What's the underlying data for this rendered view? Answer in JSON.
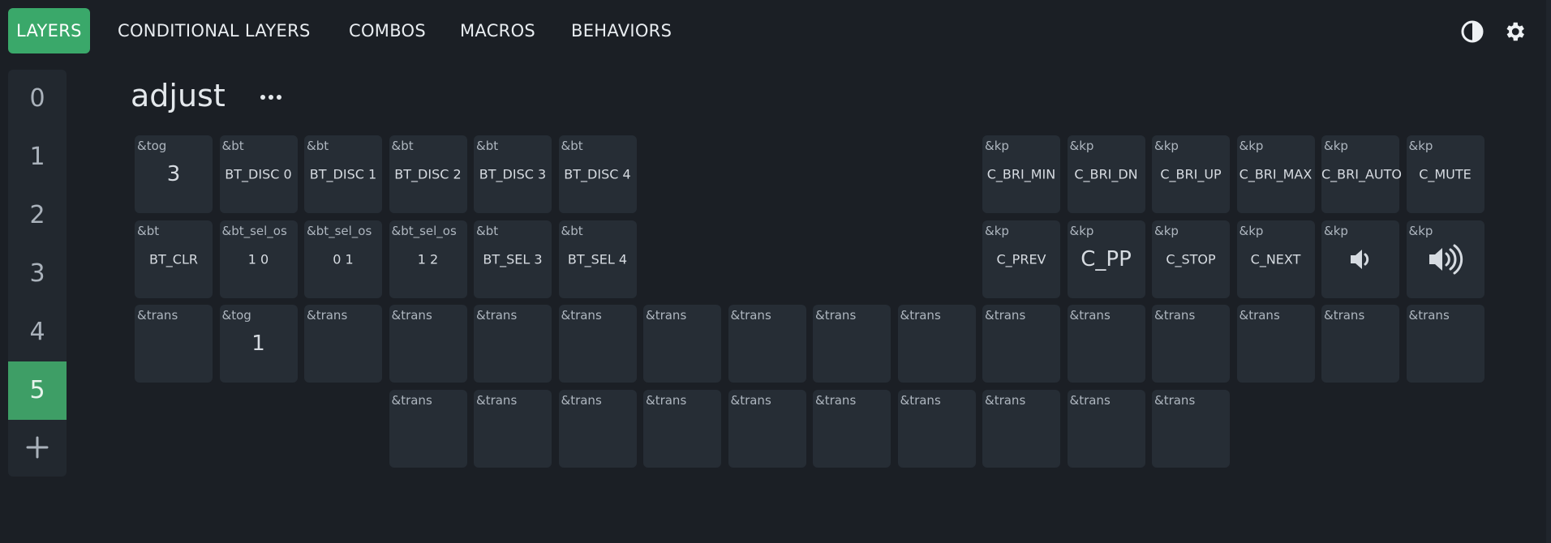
{
  "nav": {
    "tabs": [
      {
        "label": "LAYERS",
        "active": true
      },
      {
        "label": "CONDITIONAL LAYERS",
        "active": false
      },
      {
        "label": "COMBOS",
        "active": false
      },
      {
        "label": "MACROS",
        "active": false
      },
      {
        "label": "BEHAVIORS",
        "active": false
      }
    ],
    "icons": [
      "contrast-icon",
      "gear-icon"
    ]
  },
  "sidebar": {
    "layers": [
      "0",
      "1",
      "2",
      "3",
      "4",
      "5"
    ],
    "active_layer": "5",
    "add_icon": "plus-icon"
  },
  "layer": {
    "title": "adjust",
    "menu_icon": "more-horizontal-icon"
  },
  "keys": {
    "r0": [
      {
        "beh": "&tog",
        "param": "3",
        "size": "big"
      },
      {
        "beh": "&bt",
        "param": "BT_DISC 0"
      },
      {
        "beh": "&bt",
        "param": "BT_DISC 1"
      },
      {
        "beh": "&bt",
        "param": "BT_DISC 2"
      },
      {
        "beh": "&bt",
        "param": "BT_DISC 3"
      },
      {
        "beh": "&bt",
        "param": "BT_DISC 4"
      },
      {
        "beh": "&kp",
        "param": "C_BRI_MIN"
      },
      {
        "beh": "&kp",
        "param": "C_BRI_DN"
      },
      {
        "beh": "&kp",
        "param": "C_BRI_UP"
      },
      {
        "beh": "&kp",
        "param": "C_BRI_MAX"
      },
      {
        "beh": "&kp",
        "param": "C_BRI_AUTO"
      },
      {
        "beh": "&kp",
        "param": "C_MUTE"
      }
    ],
    "r1": [
      {
        "beh": "&bt",
        "param": "BT_CLR"
      },
      {
        "beh": "&bt_sel_os",
        "param": "1 0"
      },
      {
        "beh": "&bt_sel_os",
        "param": "0 1"
      },
      {
        "beh": "&bt_sel_os",
        "param": "1 2"
      },
      {
        "beh": "&bt",
        "param": "BT_SEL 3"
      },
      {
        "beh": "&bt",
        "param": "BT_SEL 4"
      },
      {
        "beh": "&kp",
        "param": "C_PREV"
      },
      {
        "beh": "&kp",
        "param": "C_PP",
        "size": "big"
      },
      {
        "beh": "&kp",
        "param": "C_STOP"
      },
      {
        "beh": "&kp",
        "param": "C_NEXT"
      },
      {
        "beh": "&kp",
        "param": "",
        "icon": "volume-down-icon"
      },
      {
        "beh": "&kp",
        "param": "",
        "icon": "volume-up-icon"
      }
    ],
    "r2": [
      {
        "beh": "&trans",
        "param": ""
      },
      {
        "beh": "&tog",
        "param": "1",
        "size": "big"
      },
      {
        "beh": "&trans",
        "param": ""
      },
      {
        "beh": "&trans",
        "param": ""
      },
      {
        "beh": "&trans",
        "param": ""
      },
      {
        "beh": "&trans",
        "param": ""
      },
      {
        "beh": "&trans",
        "param": ""
      },
      {
        "beh": "&trans",
        "param": ""
      },
      {
        "beh": "&trans",
        "param": ""
      },
      {
        "beh": "&trans",
        "param": ""
      },
      {
        "beh": "&trans",
        "param": ""
      },
      {
        "beh": "&trans",
        "param": ""
      },
      {
        "beh": "&trans",
        "param": ""
      },
      {
        "beh": "&trans",
        "param": ""
      },
      {
        "beh": "&trans",
        "param": ""
      },
      {
        "beh": "&trans",
        "param": ""
      }
    ],
    "r3": [
      {
        "beh": "&trans",
        "param": ""
      },
      {
        "beh": "&trans",
        "param": ""
      },
      {
        "beh": "&trans",
        "param": ""
      },
      {
        "beh": "&trans",
        "param": ""
      },
      {
        "beh": "&trans",
        "param": ""
      },
      {
        "beh": "&trans",
        "param": ""
      },
      {
        "beh": "&trans",
        "param": ""
      },
      {
        "beh": "&trans",
        "param": ""
      },
      {
        "beh": "&trans",
        "param": ""
      },
      {
        "beh": "&trans",
        "param": ""
      }
    ]
  },
  "colors": {
    "accent": "#3aa86a",
    "background": "#1b1f25",
    "key": "#262d35",
    "sidebar": "#22282f"
  }
}
